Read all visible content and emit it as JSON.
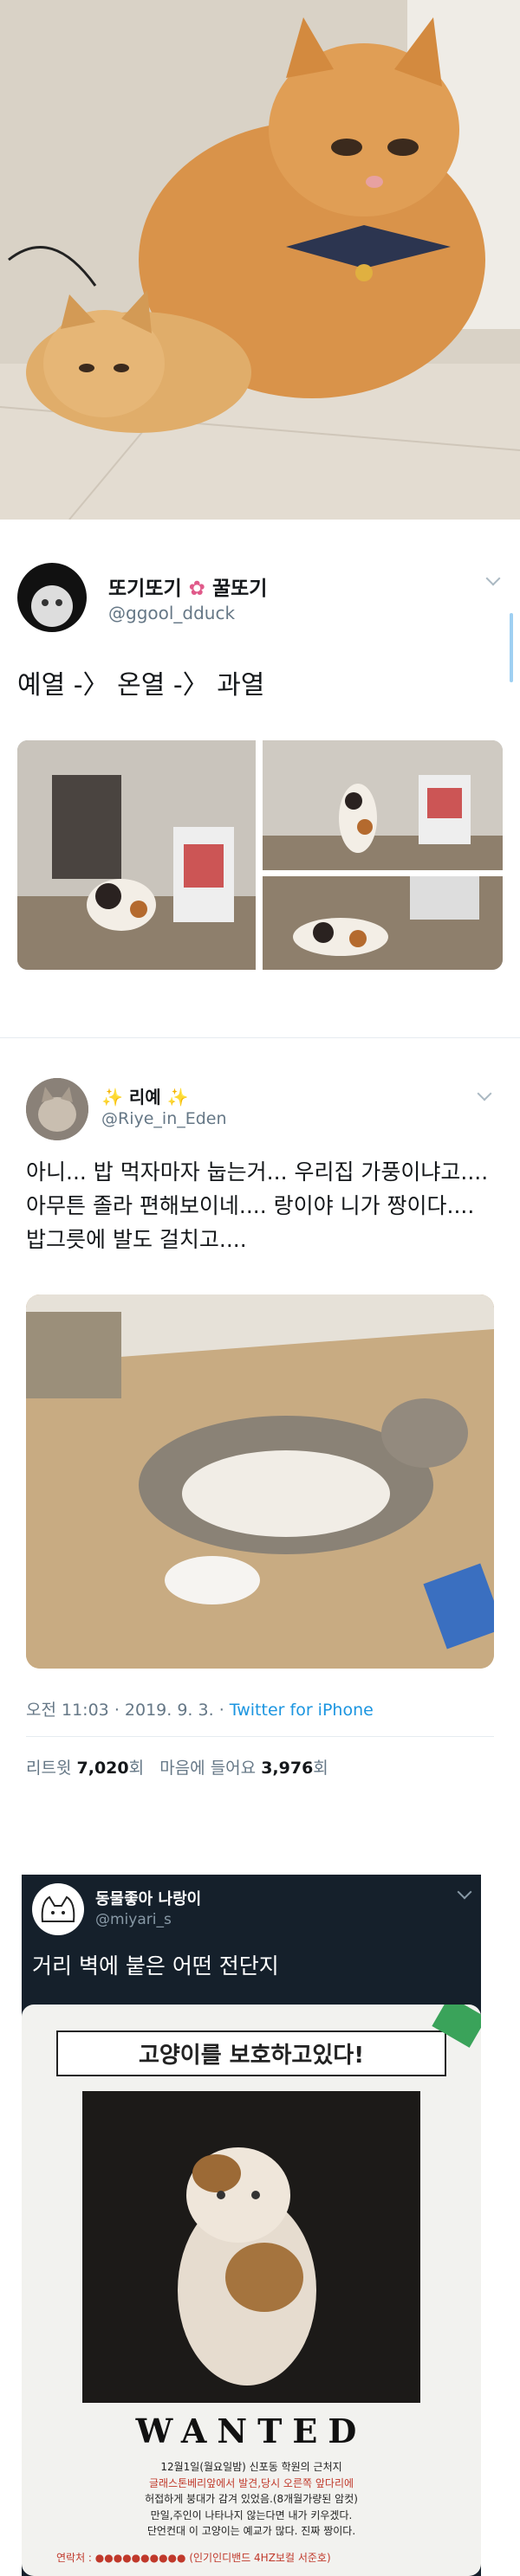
{
  "tweet1": {
    "display_name": "또기또기",
    "name_suffix": "꿀또기",
    "handle": "@ggool_dduck",
    "text": "예열 -〉 온열 -〉 과열"
  },
  "tweet2": {
    "display_name": "리예",
    "name_sparkle": "✨",
    "handle": "@Riye_in_Eden",
    "text": "아니... 밥 먹자마자 눕는거... 우리집 가풍이냐고.... 아무튼 졸라 편해보이네.... 랑이야 니가 짱이다.... 밥그릇에 발도 걸치고....",
    "time": "오전 11:03",
    "date": "2019. 9. 3.",
    "dot": "·",
    "client": "Twitter for iPhone",
    "retweets_label": "리트윗",
    "retweets_count": "7,020",
    "likes_label": "마음에 들어요",
    "likes_count": "3,976",
    "count_suffix": "회"
  },
  "tweet3": {
    "display_name": "동물좋아 나랑이",
    "handle": "@miyari_s",
    "text": "거리 벽에 붙은 어떤 전단지",
    "poster_title": "고양이를 보호하고있다!",
    "poster_wanted": "WANTED",
    "poster_line1": "12월1일(월요일밤) 신포동 학원의 근처지",
    "poster_line2": "글래스톤베리앞에서 발견,당시 오른쪽 앞다리에",
    "poster_line3": "허접하게 붕대가 감겨 있었음.(8개월가량된 암컷)",
    "poster_line4": "만일,주인이 나타나지 않는다면 내가 키우겠다.",
    "poster_line5": "단언컨대 이 고양이는 예교가 많다. 진짜 짱이다.",
    "poster_contact": "연락처 : ●●●●●●●●●● (인기인디밴드 4HZ보컬 서준호)"
  },
  "colors": {
    "link": "#1b95e0",
    "secondary": "#657786",
    "dark_card": "#15202b",
    "poster_red": "#c0392b"
  }
}
